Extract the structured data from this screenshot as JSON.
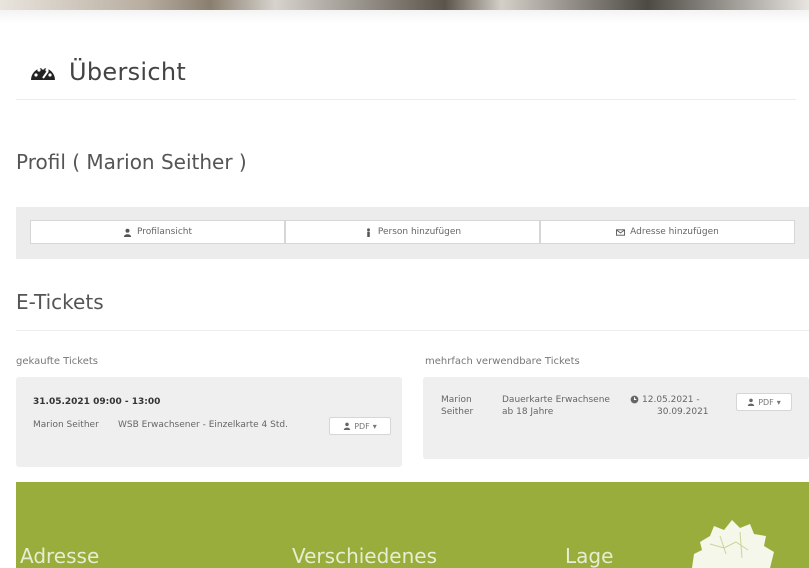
{
  "page": {
    "heading": "Übersicht",
    "heading_icon": "dashboard-icon"
  },
  "profile": {
    "title": "Profil ( Marion Seither )",
    "buttons": [
      {
        "label": "Profilansicht",
        "icon": "user-icon"
      },
      {
        "label": "Person hinzufügen",
        "icon": "person-icon"
      },
      {
        "label": "Adresse hinzufügen",
        "icon": "address-card-icon"
      }
    ]
  },
  "etickets": {
    "title": "E-Tickets",
    "bought": {
      "title": "gekaufte Tickets",
      "date": "31.05.2021 09:00 - 13:00",
      "name": "Marion Seither",
      "product": "WSB Erwachsener - Einzelkarte 4 Std.",
      "pdf_label": "PDF"
    },
    "reusable": {
      "title": "mehrfach verwendbare Tickets",
      "name_line1": "Marion",
      "name_line2": "Seither",
      "product_line1": "Dauerkarte Erwachsene",
      "product_line2": "ab 18 Jahre",
      "range_line1": "12.05.2021 -",
      "range_line2": "30.09.2021",
      "pdf_label": "PDF"
    }
  },
  "footer": {
    "col1": "Adresse",
    "col2": "Verschiedenes",
    "col3": "Lage"
  },
  "colors": {
    "footer_bg": "#98ad3b",
    "panel_bg": "#efefef"
  }
}
